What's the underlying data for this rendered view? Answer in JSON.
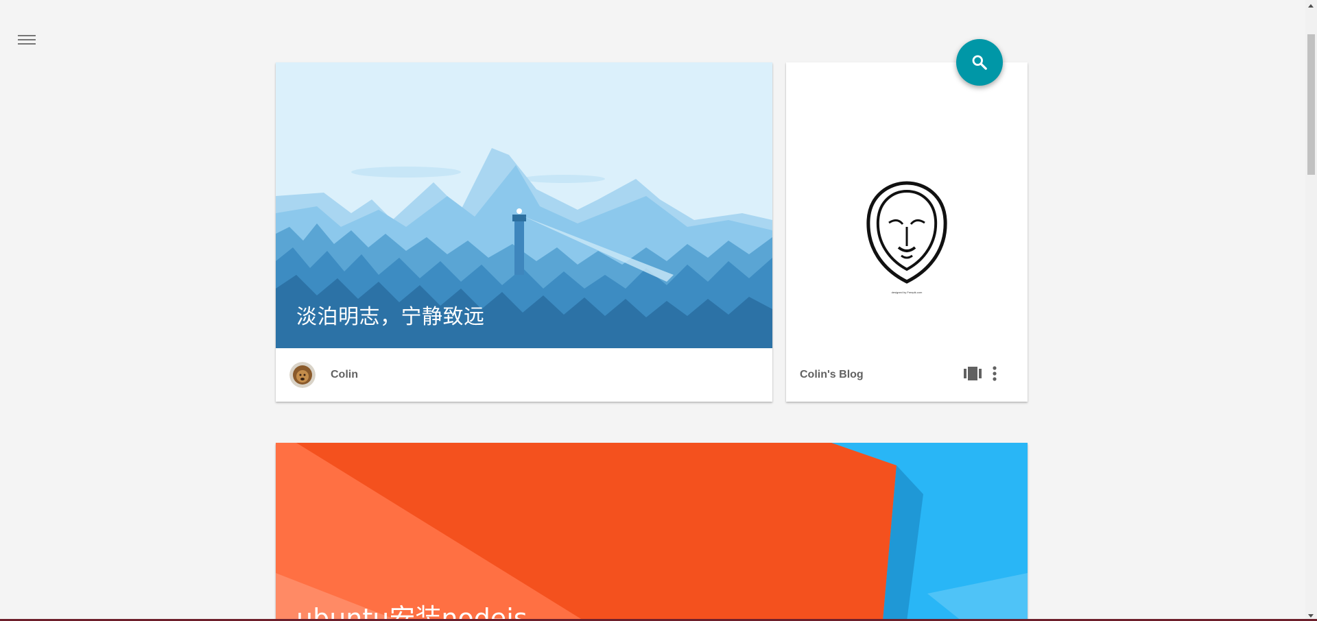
{
  "header": {
    "menu_icon": "hamburger-menu-icon",
    "search_icon": "search-icon"
  },
  "featured_card": {
    "title": "淡泊明志，宁静致远",
    "author": "Colin",
    "image": "winter mountains and lighthouse illustration",
    "avatar": "lion avatar"
  },
  "blog_card": {
    "name": "Colin's Blog",
    "image": "lion head logo",
    "caption": "designed by Freepik.com",
    "icons": [
      "view-carousel-icon",
      "more-vert-icon"
    ]
  },
  "post_card": {
    "title": "ubuntu安装nodejs",
    "image": "orange and blue abstract background"
  },
  "colors": {
    "background": "#f4f4f4",
    "fab": "#0097a7",
    "sky": "#dbf0fb",
    "orange": "#f4511e",
    "blue": "#29b6f6"
  }
}
